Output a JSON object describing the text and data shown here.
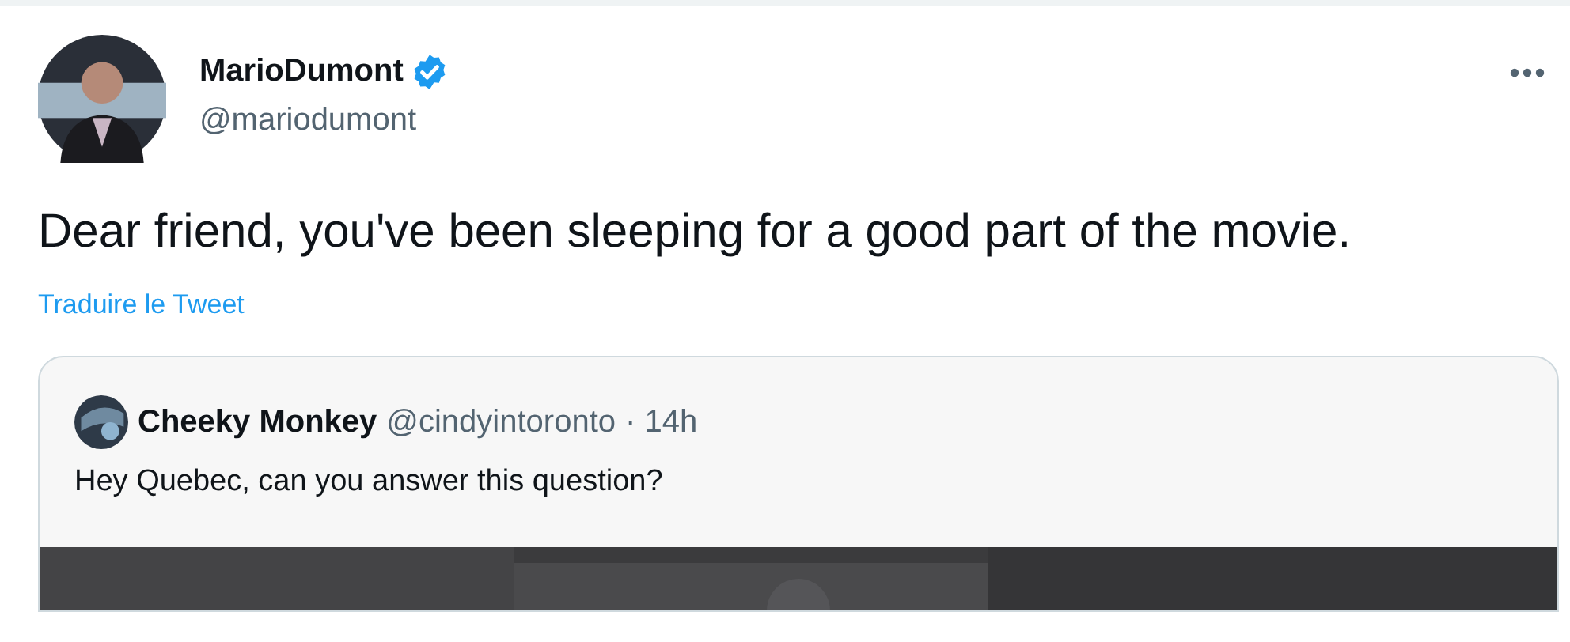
{
  "author": {
    "name": "MarioDumont",
    "verified": true,
    "handle": "@mariodumont"
  },
  "text": "Dear friend, you've been sleeping for a good part of the movie.",
  "translate_link": "Traduire le Tweet",
  "quoted": {
    "name": "Cheeky Monkey",
    "handle": "@cindyintoronto",
    "time": "· 14h",
    "text": "Hey Quebec, can you answer this question?"
  }
}
